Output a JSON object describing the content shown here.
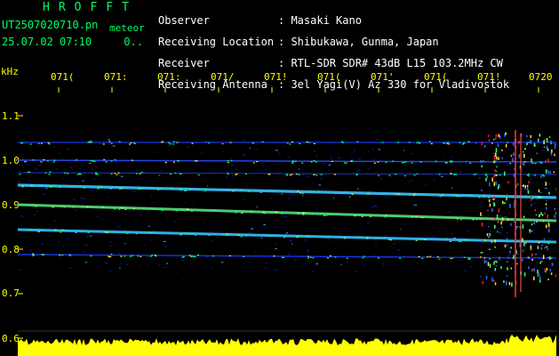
{
  "header": {
    "brand": "HROFFT",
    "filename": "UT2507020710.pn",
    "tag": "meteor",
    "datetime": "25.07.02 07:10",
    "datetime_suffix": "0..",
    "fields": [
      {
        "label": "Observer",
        "value": ": Masaki Kano"
      },
      {
        "label": "Receiving Location",
        "value": ": Shibukawa, Gunma, Japan"
      },
      {
        "label": "Receiver",
        "value": ": RTL-SDR SDR# 43dB L15 103.2MHz CW"
      },
      {
        "label": "Receiving Antenna",
        "value": ": 3el Yagi(V) Az 330 for Vladivostok"
      }
    ]
  },
  "time_axis": [
    "071(",
    "071:",
    "071:",
    "071/",
    "071!",
    "071(",
    "071'",
    "071(",
    "071!",
    "0720"
  ],
  "freq_axis": {
    "unit": "kHz",
    "ticks": [
      "1.1",
      "1.0",
      "0.9",
      "0.8",
      "0.7",
      "0.6"
    ]
  },
  "colors": {
    "background": "#000000",
    "accent_green": "#00ff66",
    "text_white": "#ffffff",
    "axis_yellow": "#ffff00",
    "signal_blue": "#1a3cff",
    "signal_hot": "#ff2020"
  }
}
